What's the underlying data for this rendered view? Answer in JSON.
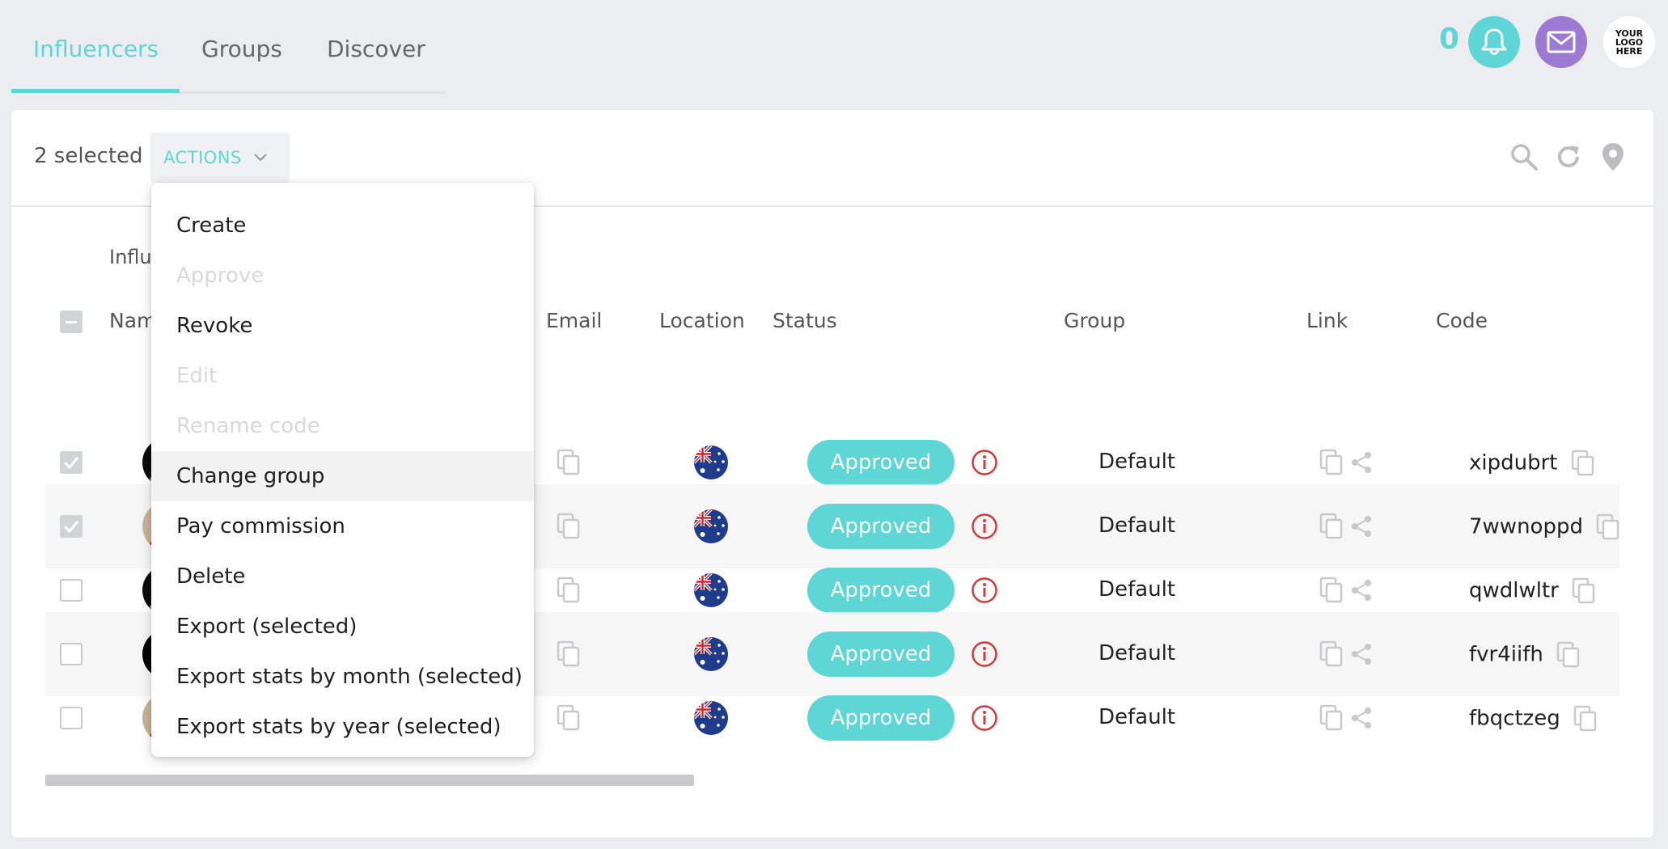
{
  "tabs": [
    {
      "label": "Influencers",
      "active": true
    },
    {
      "label": "Groups",
      "active": false
    },
    {
      "label": "Discover",
      "active": false
    }
  ],
  "header": {
    "notification_count": "0",
    "logo_text": "YOUR\nLOGO\nHERE",
    "accent_color": "#5ed6d6",
    "mail_color": "#9d7ad1"
  },
  "toolbar": {
    "selected_text": "2 selected",
    "actions_label": "ACTIONS",
    "icons": [
      "search-icon",
      "refresh-icon",
      "location-pin-icon"
    ]
  },
  "table": {
    "section_label": "Influ",
    "columns": {
      "name": "Nam",
      "email": "Email",
      "location": "Location",
      "status": "Status",
      "group": "Group",
      "link": "Link",
      "code": "Code"
    },
    "rows": [
      {
        "checked": true,
        "avatar": "rocket-avatar",
        "country": "Australia",
        "status": "Approved",
        "group": "Default",
        "code": "xipdubrt"
      },
      {
        "checked": true,
        "avatar": "person-avatar",
        "country": "Australia",
        "status": "Approved",
        "group": "Default",
        "code": "7wwnoppd"
      },
      {
        "checked": false,
        "avatar": "rocket-avatar",
        "country": "Australia",
        "status": "Approved",
        "group": "Default",
        "code": "qwdlwltr"
      },
      {
        "checked": false,
        "avatar": "x-logo-avatar",
        "country": "Australia",
        "status": "Approved",
        "group": "Default",
        "code": "fvr4iifh"
      },
      {
        "checked": false,
        "avatar": "person-avatar",
        "country": "Australia",
        "status": "Approved",
        "group": "Default",
        "code": "fbqctzeg"
      }
    ]
  },
  "actions_menu": {
    "items": [
      {
        "label": "Create",
        "enabled": true
      },
      {
        "label": "Approve",
        "enabled": false
      },
      {
        "label": "Revoke",
        "enabled": true
      },
      {
        "label": "Edit",
        "enabled": false
      },
      {
        "label": "Rename code",
        "enabled": false
      },
      {
        "label": "Change group",
        "enabled": true,
        "hovered": true
      },
      {
        "label": "Pay commission",
        "enabled": true
      },
      {
        "label": "Delete",
        "enabled": true
      },
      {
        "label": "Export (selected)",
        "enabled": true
      },
      {
        "label": "Export stats by month (selected)",
        "enabled": true
      },
      {
        "label": "Export stats by year (selected)",
        "enabled": true
      }
    ]
  }
}
